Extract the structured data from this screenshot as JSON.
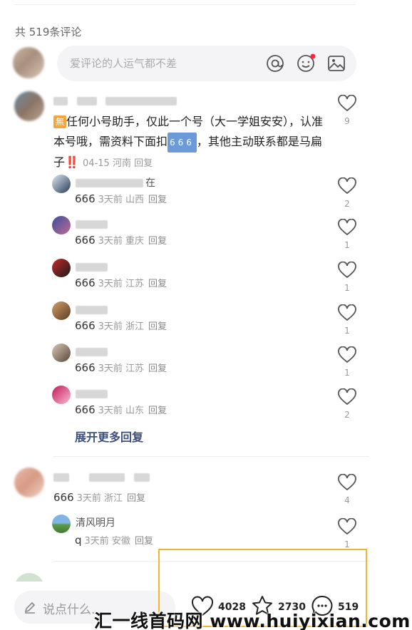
{
  "header": {
    "comment_count": "共 519条评论"
  },
  "input": {
    "placeholder": "爱评论的人运气都不差"
  },
  "comments": [
    {
      "badge": "無",
      "text": "任何小号助手，仅此一个号（大一学姐安安），认准本号哦，需资料下面扣",
      "emoji": "666",
      "text_tail": "，其他主动联系都是马扁子‼️",
      "meta": "04-15 河南",
      "reply": "回复",
      "likes": "9"
    },
    {
      "text": "666",
      "meta": "3天前 浙江",
      "reply": "回复",
      "likes": "4"
    }
  ],
  "replies": [
    {
      "name_tail": "在",
      "text": "666",
      "meta": "3天前 山西",
      "reply": "回复",
      "likes": "2"
    },
    {
      "text": "666",
      "meta": "3天前 重庆",
      "reply": "回复",
      "likes": "1"
    },
    {
      "text": "666",
      "meta": "3天前 江苏",
      "reply": "回复",
      "likes": "1"
    },
    {
      "text": "666",
      "meta": "3天前 浙江",
      "reply": "回复",
      "likes": "1"
    },
    {
      "text": "666",
      "meta": "3天前 江苏",
      "reply": "回复",
      "likes": "1"
    },
    {
      "text": "666",
      "meta": "3天前 山东",
      "reply": "回复",
      "likes": "2"
    }
  ],
  "expand_more": "展开更多回复",
  "reply2": {
    "name": "清风明月",
    "text": "q",
    "meta": "3天前 安徽",
    "reply": "回复",
    "likes": "1"
  },
  "bottom_bar": {
    "say_placeholder": "说点什么...",
    "likes": "4028",
    "favorites": "2730",
    "comments": "519"
  },
  "watermark": "汇一线首码网 www.huiyixian.com",
  "colors": {
    "accent_red": "#ff2442",
    "link_blue": "#3c4f7e",
    "highlight": "#f5b32e"
  }
}
